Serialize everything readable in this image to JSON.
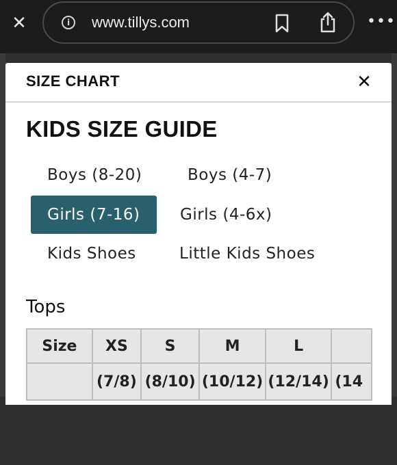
{
  "browser": {
    "close_label": "✕",
    "url": "www.tillys.com",
    "more_label": "•••"
  },
  "modal": {
    "title": "SIZE CHART",
    "close_label": "✕"
  },
  "guide": {
    "title": "KIDS SIZE GUIDE",
    "tabs": [
      {
        "label": "Boys (8-20)"
      },
      {
        "label": "Boys (4-7)"
      },
      {
        "label": "Girls (7-16)"
      },
      {
        "label": "Girls (4-6x)"
      },
      {
        "label": "Kids Shoes"
      },
      {
        "label": "Little Kids Shoes"
      }
    ],
    "active_tab": "Girls (7-16)",
    "accent_color": "#2a5f6e"
  },
  "tops": {
    "title": "Tops",
    "headers": [
      "Size",
      "XS",
      "S",
      "M",
      "L",
      ""
    ],
    "row1": [
      "",
      "(7/8)",
      "(8/10)",
      "(10/12)",
      "(12/14)",
      "(14"
    ]
  }
}
